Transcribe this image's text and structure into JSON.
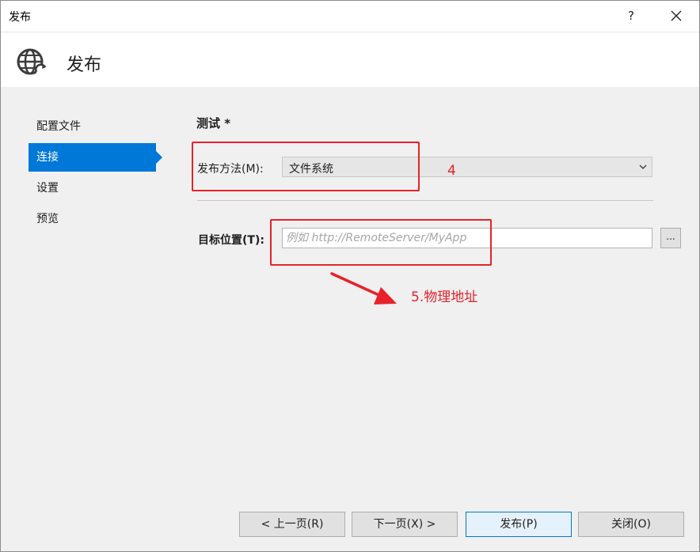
{
  "window": {
    "title": "发布",
    "help_label": "?",
    "close_icon": "close-icon"
  },
  "header": {
    "title": "发布",
    "icon": "globe-publish-icon"
  },
  "sidebar": {
    "items": [
      {
        "label": "配置文件",
        "active": false
      },
      {
        "label": "连接",
        "active": true
      },
      {
        "label": "设置",
        "active": false
      },
      {
        "label": "预览",
        "active": false
      }
    ]
  },
  "main": {
    "section_title": "测试 *",
    "publish_method": {
      "label": "发布方法(M):",
      "value": "文件系统"
    },
    "target_location": {
      "label": "目标位置(T):",
      "value": "",
      "placeholder": "例如 http://RemoteServer/MyApp",
      "browse_label": "..."
    }
  },
  "annotations": {
    "step4": "4",
    "step5": "5.物理地址",
    "color": "#e8212a"
  },
  "footer": {
    "prev_label": "< 上一页(R)",
    "next_label": "下一页(X) >",
    "publish_label": "发布(P)",
    "close_label": "关闭(O)"
  },
  "colors": {
    "accent": "#0078d7",
    "background": "#f0f0f0",
    "annotation": "#e8212a"
  }
}
